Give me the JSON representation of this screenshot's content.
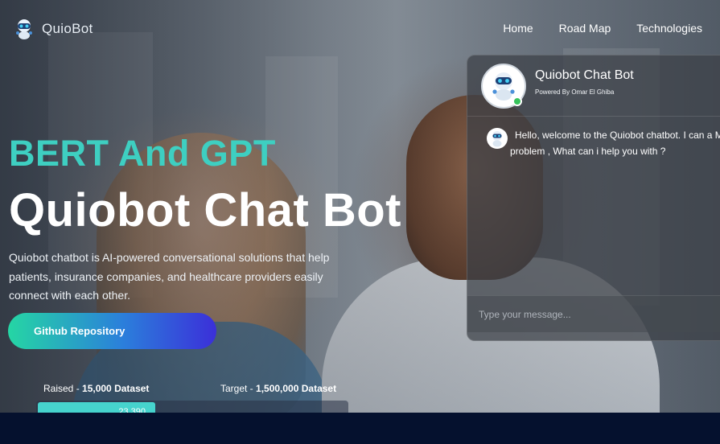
{
  "brand": {
    "name": "QuioBot",
    "logo_icon": "robot-icon"
  },
  "nav": {
    "links": [
      "Home",
      "Road Map",
      "Technologies"
    ]
  },
  "hero": {
    "kicker": "BERT And GPT",
    "title": "Quiobot Chat Bot",
    "description": "Quiobot chatbot is AI-powered conversational solutions that help patients, insurance companies, and healthcare providers easily connect with each other.",
    "cta_label": "Github Repository"
  },
  "funding": {
    "raised_label": "Raised - ",
    "raised_value": "15,000 Dataset",
    "target_label": "Target - ",
    "target_value": "1,500,000 Dataset",
    "progress_value": "23,390",
    "progress_fraction": 0.38
  },
  "chat": {
    "title": "Quiobot Chat Bot",
    "subtitle": "Powered By Omar El Ghiba",
    "status": "online",
    "welcome_message": "Hello, welcome to the Quiobot chatbot. I can a Medical problem , What can i help you with ?",
    "input_placeholder": "Type your message..."
  },
  "colors": {
    "kicker": "#3ecfc1",
    "cta_gradient_start": "#25d6a4",
    "cta_gradient_end": "#3b2fd9",
    "progress_fill": "#46d3cd",
    "bottom_band": "#05112e",
    "online": "#37c35b"
  }
}
